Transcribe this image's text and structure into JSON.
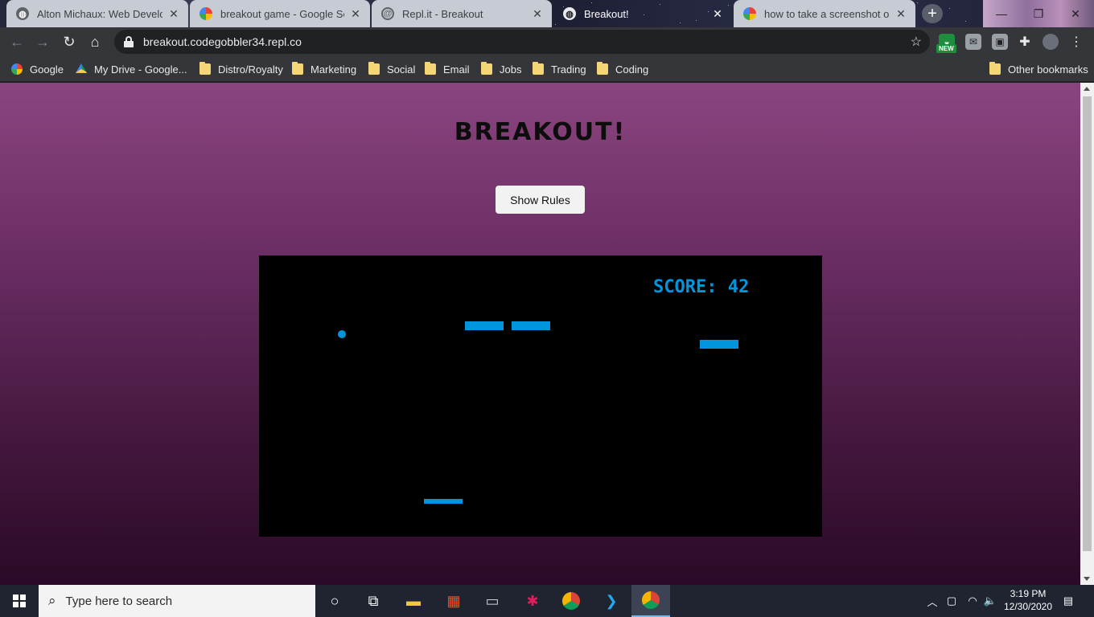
{
  "browser": {
    "tabs": [
      {
        "title": "Alton Michaux: Web Develope",
        "favicon": "globe-icon",
        "state": "inactive"
      },
      {
        "title": "breakout game - Google Sear",
        "favicon": "google-icon",
        "state": "inactive"
      },
      {
        "title": "Repl.it - Breakout",
        "favicon": "replit-icon",
        "state": "inactive"
      },
      {
        "title": "Breakout!",
        "favicon": "globe-icon",
        "state": "active"
      },
      {
        "title": "how to take a screenshot on",
        "favicon": "google-icon",
        "state": "inactive"
      }
    ],
    "new_tab_glyph": "+",
    "close_glyph": "✕",
    "window_controls": {
      "minimize": "—",
      "maximize": "❐",
      "close": "✕"
    },
    "url": "breakout.codegobbler34.repl.co",
    "new_badge": "NEW",
    "bookmarks": [
      {
        "label": "Google",
        "icon": "google-icon"
      },
      {
        "label": "My Drive - Google...",
        "icon": "drive-icon"
      },
      {
        "label": "Distro/Royalty",
        "icon": "folder-icon"
      },
      {
        "label": "Marketing",
        "icon": "folder-icon"
      },
      {
        "label": "Social",
        "icon": "folder-icon"
      },
      {
        "label": "Email",
        "icon": "folder-icon"
      },
      {
        "label": "Jobs",
        "icon": "folder-icon"
      },
      {
        "label": "Trading",
        "icon": "folder-icon"
      },
      {
        "label": "Coding",
        "icon": "folder-icon"
      }
    ],
    "other_bookmarks": "Other bookmarks"
  },
  "page": {
    "title": "Breakout!",
    "rules_button": "Show Rules",
    "background_top": "#8a457f",
    "background_bottom": "#2a0a26"
  },
  "game": {
    "score_text": "SCORE: 42",
    "accent_color": "#0095dd"
  },
  "taskbar": {
    "search_placeholder": "Type here to search",
    "time": "3:19 PM",
    "date": "12/30/2020"
  }
}
